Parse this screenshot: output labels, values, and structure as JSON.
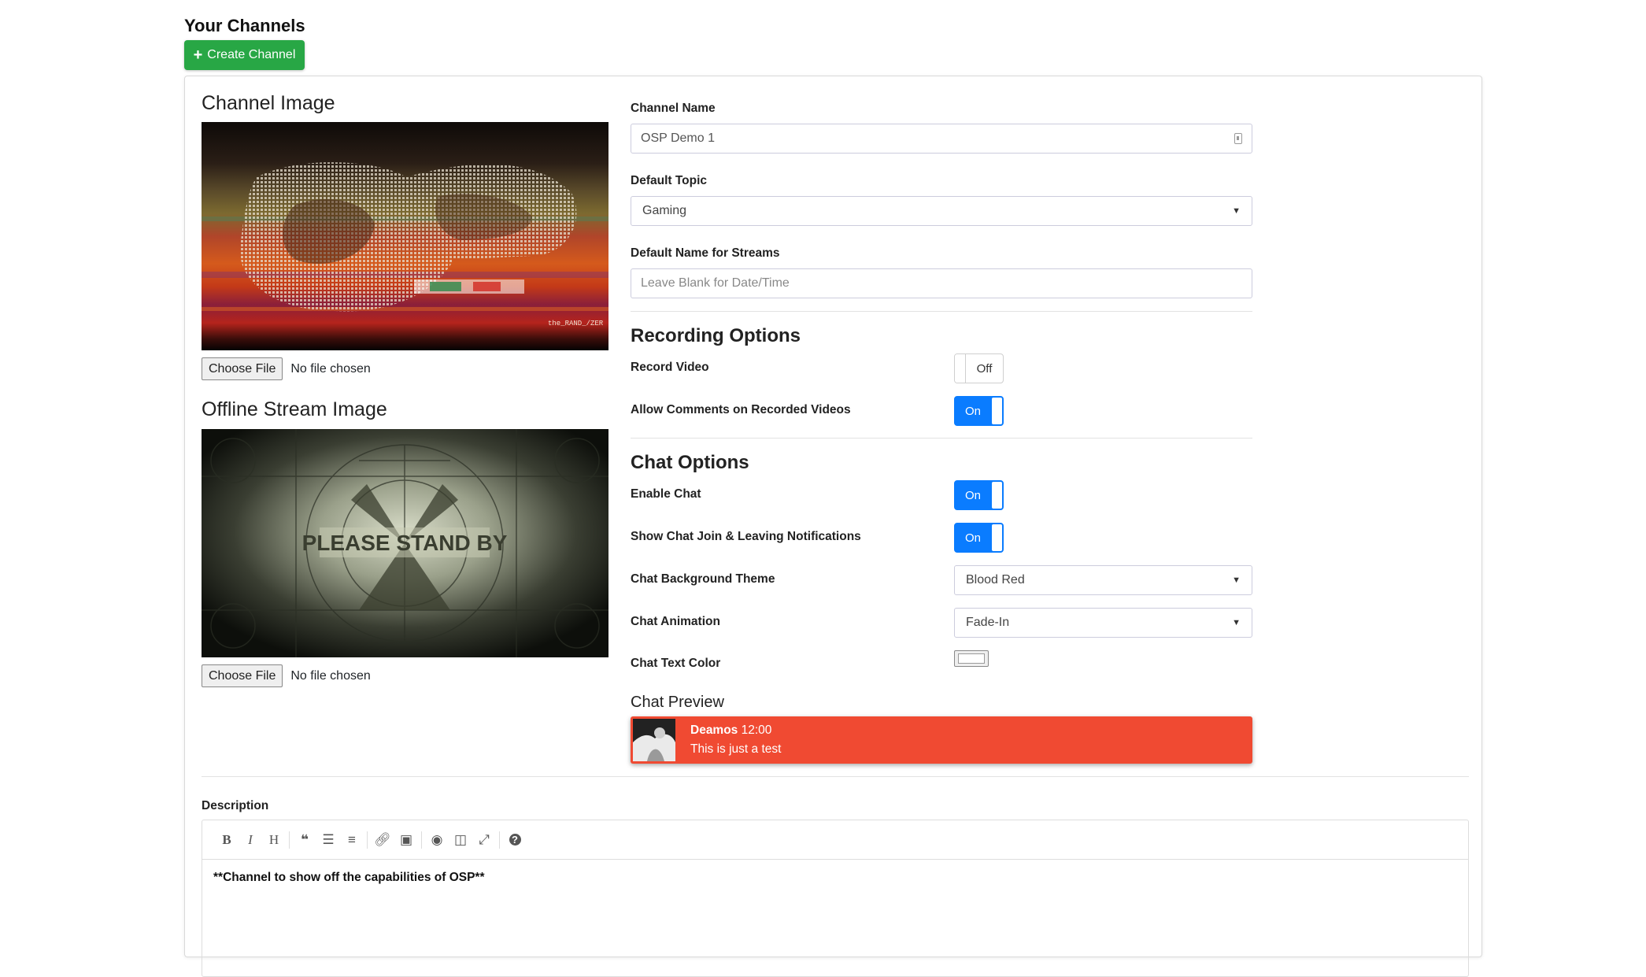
{
  "page": {
    "title": "Your Channels",
    "create_label": "Create Channel"
  },
  "images": {
    "channel_heading": "Channel Image",
    "offline_heading": "Offline Stream Image",
    "choose_label": "Choose File",
    "no_file": "No file chosen",
    "offline_text": "PLEASE STAND BY",
    "channel_wordmark_credit": "the_RAND_/ZER"
  },
  "form": {
    "channel_name_label": "Channel Name",
    "channel_name_value": "OSP Demo 1",
    "default_topic_label": "Default Topic",
    "default_topic_value": "Gaming",
    "default_stream_name_label": "Default Name for Streams",
    "default_stream_name_placeholder": "Leave Blank for Date/Time"
  },
  "recording": {
    "heading": "Recording Options",
    "record_video_label": "Record Video",
    "record_video_state": "Off",
    "allow_comments_label": "Allow Comments on Recorded Videos",
    "allow_comments_state": "On"
  },
  "chat": {
    "heading": "Chat Options",
    "enable_chat_label": "Enable Chat",
    "enable_chat_state": "On",
    "notifications_label": "Show Chat Join & Leaving Notifications",
    "notifications_state": "On",
    "bg_theme_label": "Chat Background Theme",
    "bg_theme_value": "Blood Red",
    "animation_label": "Chat Animation",
    "animation_value": "Fade-In",
    "text_color_label": "Chat Text Color",
    "text_color_value": "#ffffff",
    "preview_heading": "Chat Preview",
    "preview_user": "Deamos",
    "preview_time": "12:00",
    "preview_message": "This is just a test",
    "preview_bg_color": "#f04a32"
  },
  "description": {
    "label": "Description",
    "content": "**Channel to show off the capabilities of OSP**",
    "toolbar": [
      "bold-icon",
      "italic-icon",
      "heading-icon",
      "quote-icon",
      "unordered-list-icon",
      "ordered-list-icon",
      "link-icon",
      "image-icon",
      "preview-icon",
      "side-by-side-icon",
      "fullscreen-icon",
      "help-icon"
    ]
  },
  "colors": {
    "success": "#28a745",
    "primary": "#0a7cff",
    "chat_bg": "#f04a32"
  }
}
